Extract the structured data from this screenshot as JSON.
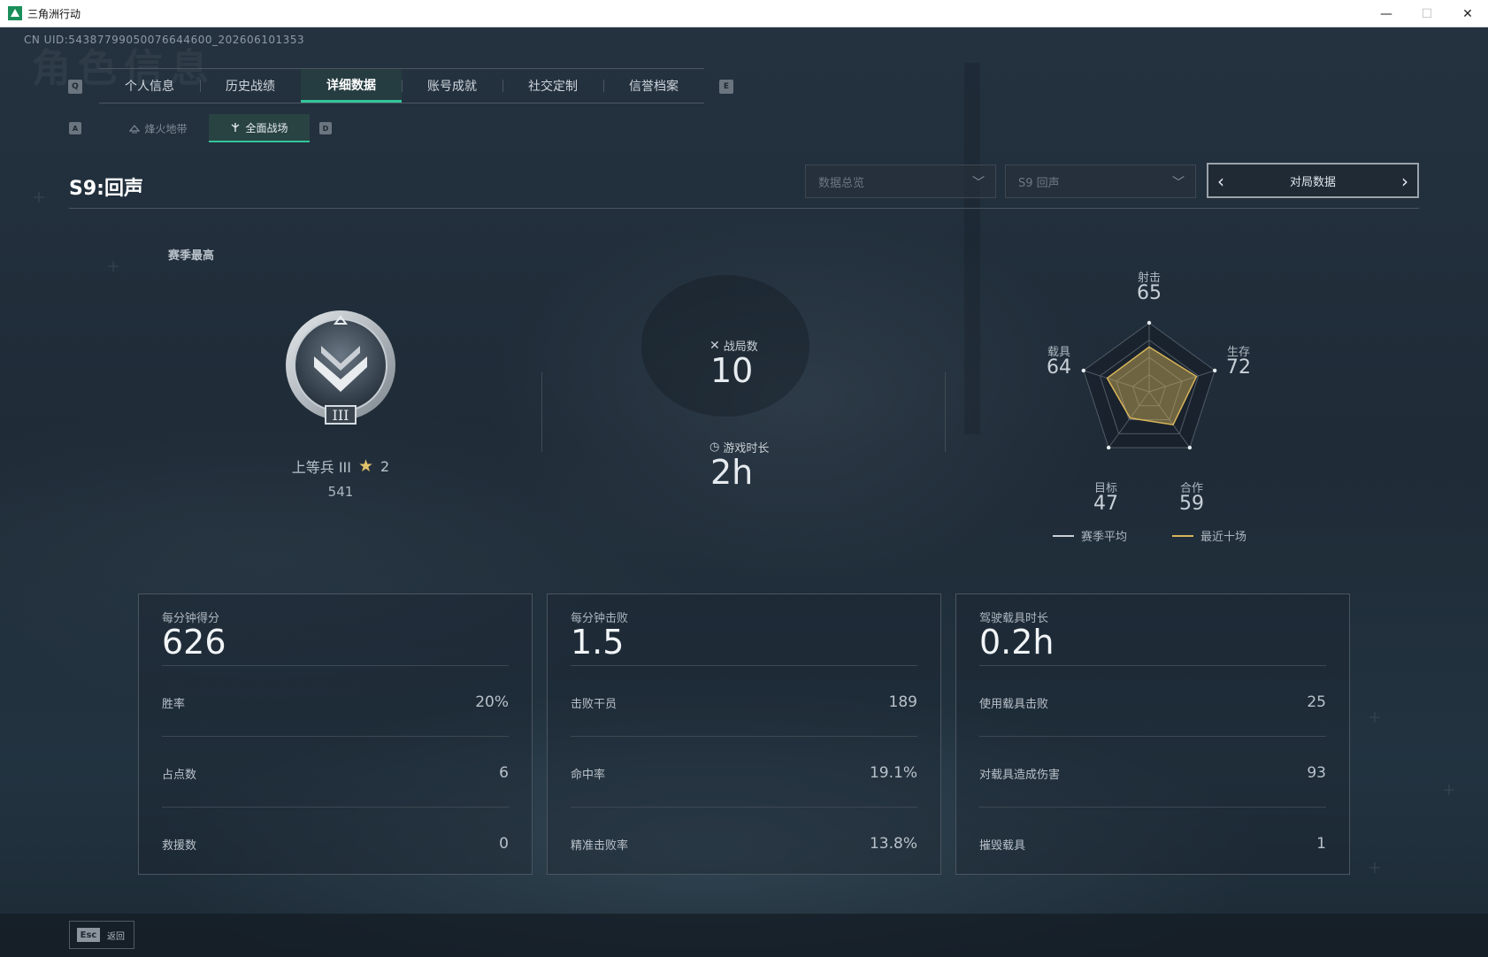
{
  "window": {
    "title": "三角洲行动",
    "controls": {
      "minimize": "—",
      "maximize": "☐",
      "close": "✕"
    }
  },
  "uid_text": "CN UID:5438779905007664​4600_202606101353",
  "ghost_title": "角色信息",
  "tabs": {
    "left_key": "Q",
    "right_key": "E",
    "items": [
      {
        "label": "个人信息"
      },
      {
        "label": "历史战绩"
      },
      {
        "label": "详细数据",
        "active": true
      },
      {
        "label": "账号成就"
      },
      {
        "label": "社交定制"
      },
      {
        "label": "信誉档案"
      }
    ]
  },
  "subtabs": {
    "left_key": "A",
    "right_key": "D",
    "items": [
      {
        "label": "烽火地带",
        "icon": "map-icon"
      },
      {
        "label": "全面战场",
        "icon": "battlefield-icon",
        "active": true
      }
    ]
  },
  "season_title": "S9:回声",
  "filters": {
    "data_type": {
      "value": "数据总览"
    },
    "season": {
      "value": "S9 回声"
    },
    "pager": {
      "label": "对局数据"
    }
  },
  "rank": {
    "season_best_label": "赛季最高",
    "name": "上等兵 III",
    "stars": "2",
    "points": "541",
    "badge_numeral": "III"
  },
  "overview": {
    "matches": {
      "label": "战局数",
      "value": "10",
      "icon": "crossed-swords-icon"
    },
    "playtime": {
      "label": "游戏时长",
      "value": "2h",
      "icon": "clock-icon"
    }
  },
  "radar": {
    "axes": [
      {
        "label": "射击",
        "value": 65
      },
      {
        "label": "生存",
        "value": 72
      },
      {
        "label": "合作",
        "value": 59
      },
      {
        "label": "目标",
        "value": 47
      },
      {
        "label": "载具",
        "value": 64
      }
    ],
    "max": 100,
    "legend": [
      {
        "label": "赛季平均",
        "color": "#c9d0d6"
      },
      {
        "label": "最近十场",
        "color": "#d8b55a"
      }
    ]
  },
  "cards": [
    {
      "head_label": "每分钟得分",
      "head_value": "626",
      "rows": [
        {
          "label": "胜率",
          "value": "20%"
        },
        {
          "label": "占点数",
          "value": "6"
        },
        {
          "label": "救援数",
          "value": "0"
        }
      ]
    },
    {
      "head_label": "每分钟击败",
      "head_value": "1.5",
      "rows": [
        {
          "label": "击败干员",
          "value": "189"
        },
        {
          "label": "命中率",
          "value": "19.1%"
        },
        {
          "label": "精准击败率",
          "value": "13.8%"
        }
      ]
    },
    {
      "head_label": "驾驶载具时长",
      "head_value": "0.2h",
      "rows": [
        {
          "label": "使用载具击败",
          "value": "25"
        },
        {
          "label": "对载具造成伤害",
          "value": "93"
        },
        {
          "label": "摧毁载具",
          "value": "1"
        }
      ]
    }
  ],
  "footer": {
    "esc_key": "Esc",
    "back_label": "返回"
  },
  "colors": {
    "accent": "#34c59a",
    "radar_recent": "#d8b55a"
  }
}
